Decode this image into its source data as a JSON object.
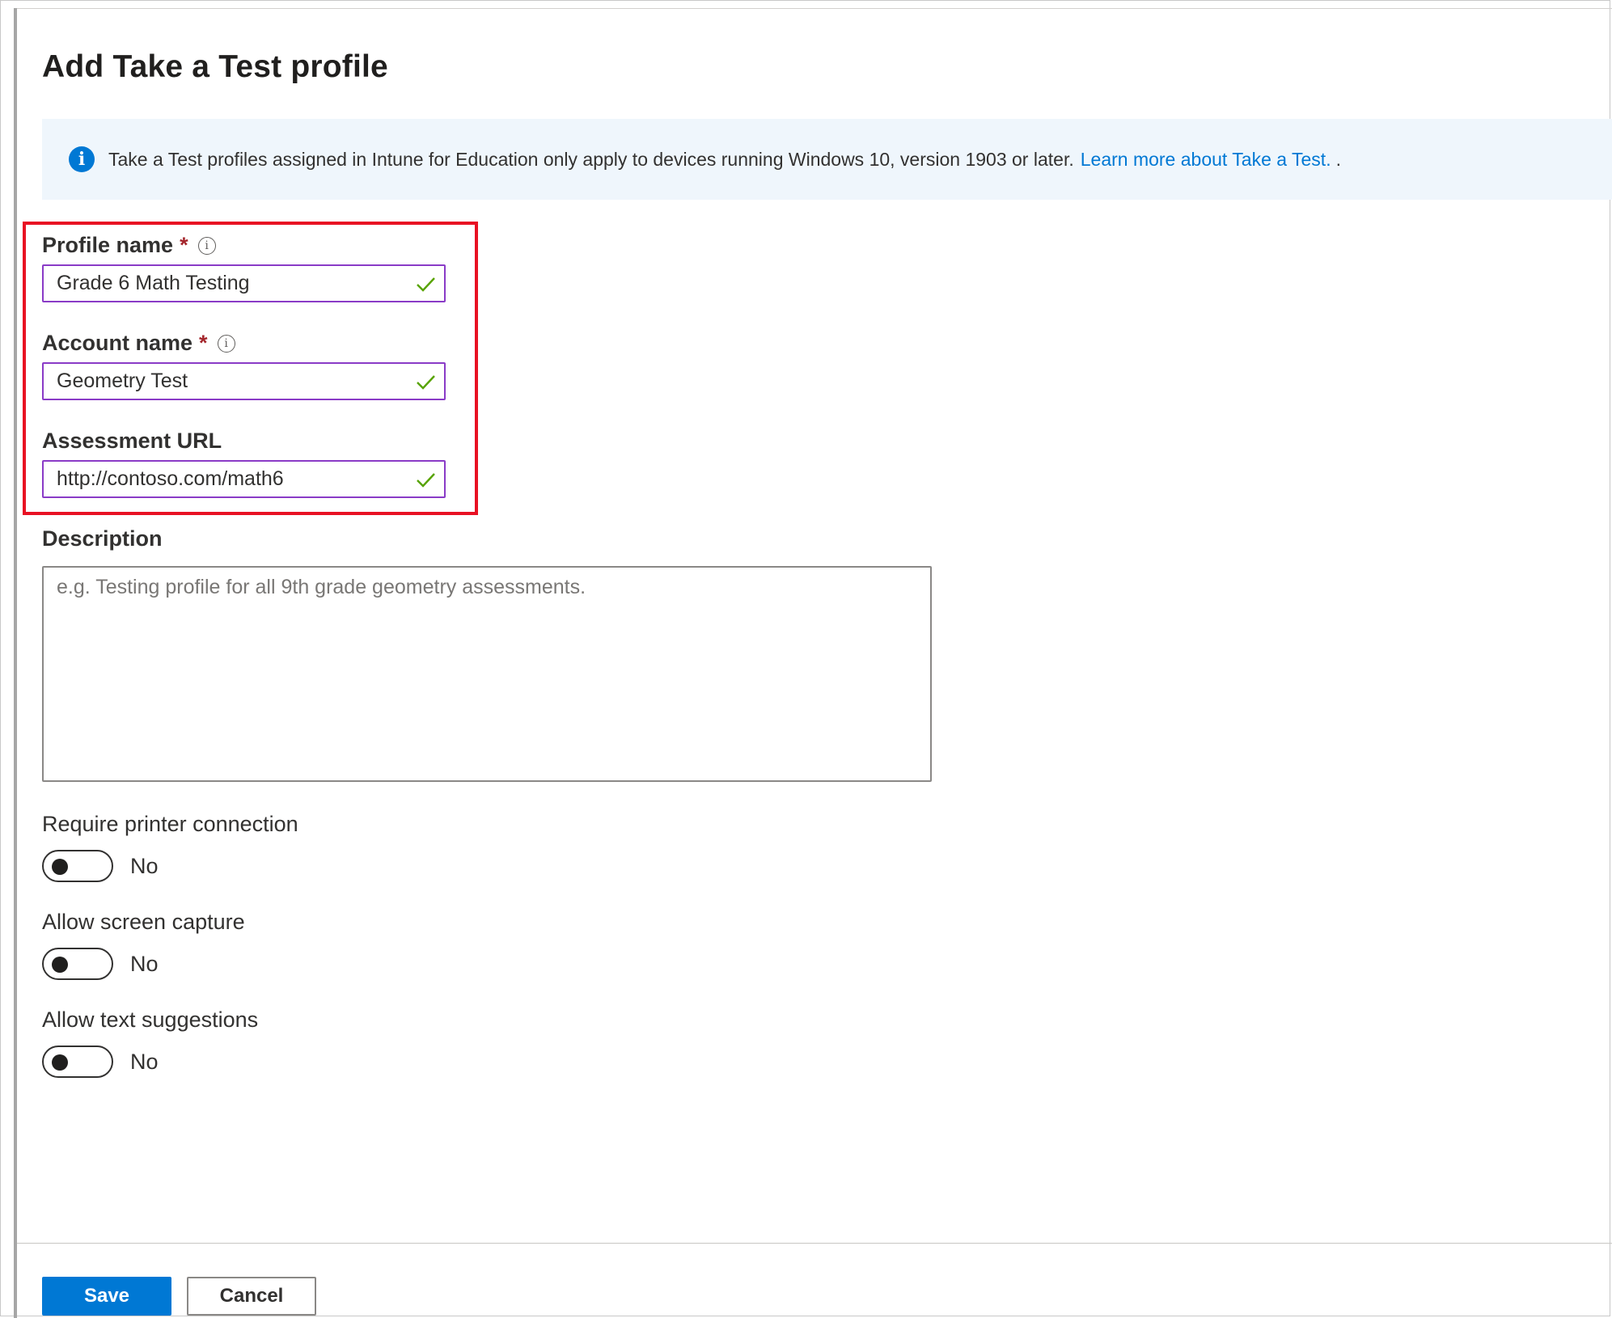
{
  "title": "Add Take a Test profile",
  "info_bar": {
    "icon": "info-icon",
    "message": "Take a Test profiles assigned in Intune for Education only apply to devices running Windows 10, version 1903 or later.",
    "link_text": "Learn more about Take a Test.",
    "trailing": "."
  },
  "fields": {
    "profile_name": {
      "label": "Profile name",
      "required": "*",
      "value": "Grade 6 Math Testing"
    },
    "account_name": {
      "label": "Account name",
      "required": "*",
      "value": "Geometry Test"
    },
    "assessment_url": {
      "label": "Assessment URL",
      "value": "http://contoso.com/math6"
    },
    "description": {
      "label": "Description",
      "placeholder": "e.g. Testing profile for all 9th grade geometry assessments."
    }
  },
  "toggles": [
    {
      "label": "Require printer connection",
      "state": "No"
    },
    {
      "label": "Allow screen capture",
      "state": "No"
    },
    {
      "label": "Allow text suggestions",
      "state": "No"
    }
  ],
  "buttons": {
    "save": "Save",
    "cancel": "Cancel"
  },
  "colors": {
    "accent": "#0078d4",
    "input_border": "#8a3bc7",
    "check": "#57a300",
    "highlight": "#e81123",
    "required": "#a4262c"
  }
}
